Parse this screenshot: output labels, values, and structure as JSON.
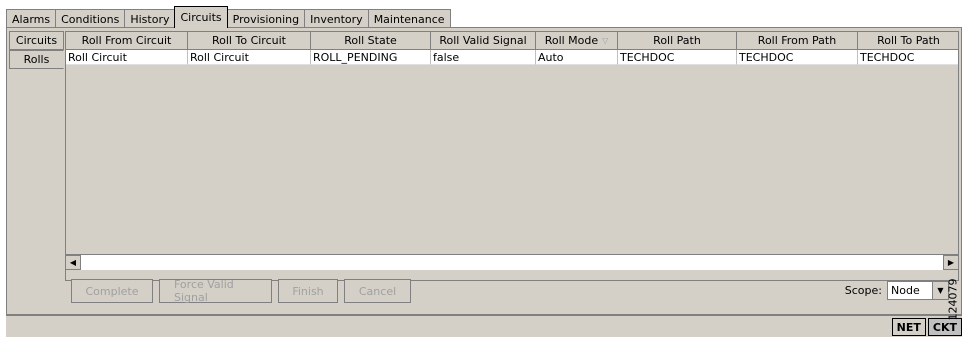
{
  "tabs": [
    "Alarms",
    "Conditions",
    "History",
    "Circuits",
    "Provisioning",
    "Inventory",
    "Maintenance"
  ],
  "active_tab": "Circuits",
  "subtabs": [
    "Circuits",
    "Rolls"
  ],
  "active_subtab": "Rolls",
  "table": {
    "headers": [
      "Roll From Circuit",
      "Roll To Circuit",
      "Roll State",
      "Roll Valid Signal",
      "Roll Mode",
      "Roll Path",
      "Roll From Path",
      "Roll To Path"
    ],
    "sorted_column_icon": "sort-descending-icon",
    "rows": [
      [
        "Roll Circuit",
        "Roll Circuit",
        "ROLL_PENDING",
        "false",
        "Auto",
        "TECHDOC",
        "TECHDOC",
        "TECHDOC"
      ]
    ]
  },
  "buttons": {
    "complete": "Complete",
    "force_valid_signal": "Force Valid Signal",
    "finish": "Finish",
    "cancel": "Cancel"
  },
  "scope": {
    "label": "Scope:",
    "value": "Node"
  },
  "status": {
    "net": "NET",
    "ckt": "CKT"
  },
  "figure_id": "124079"
}
